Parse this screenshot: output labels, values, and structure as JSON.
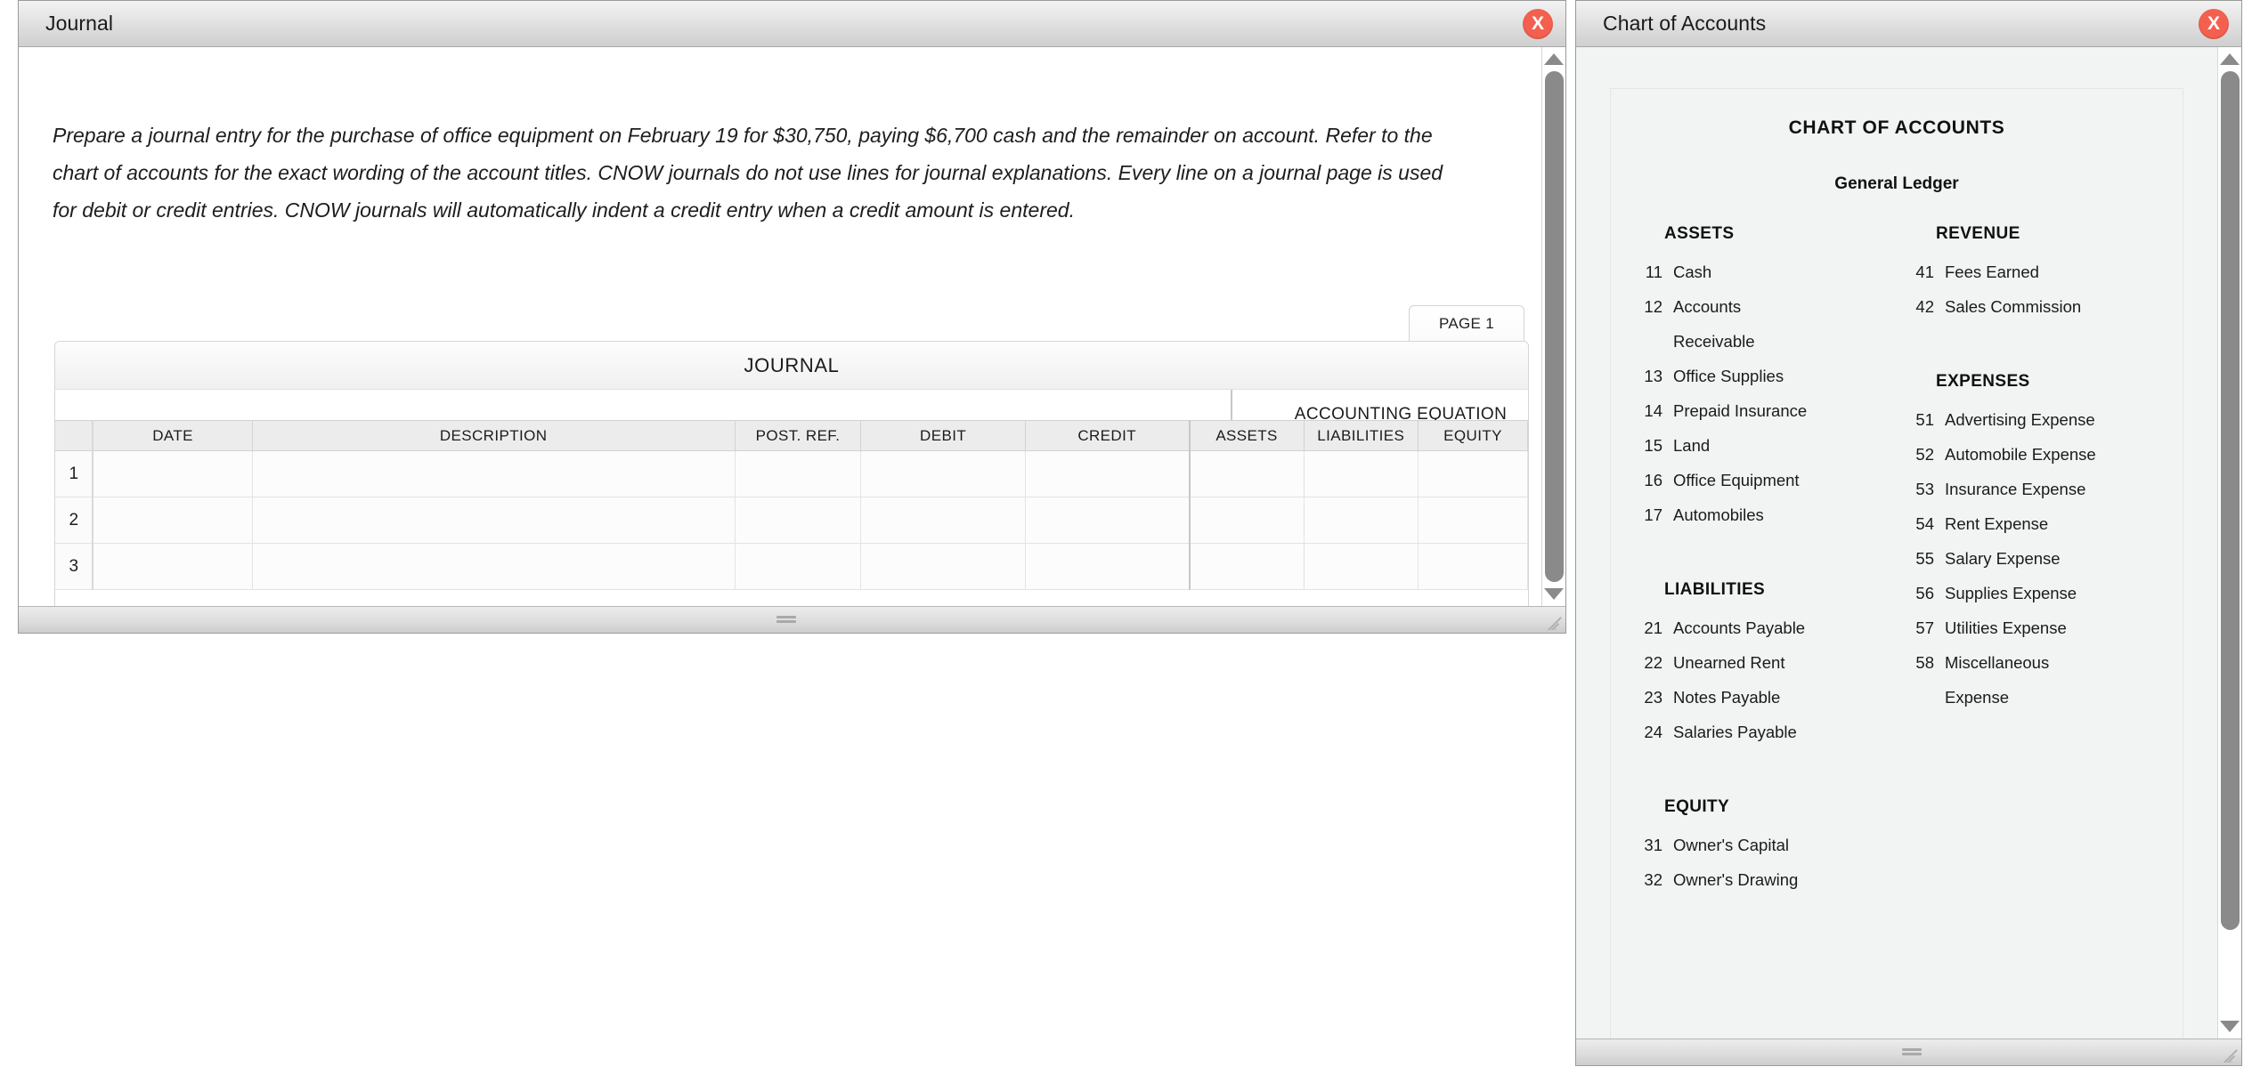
{
  "journal_window": {
    "title": "Journal",
    "close_label": "X",
    "instructions": "Prepare a journal entry for the purchase of office equipment on February 19 for $30,750, paying $6,700 cash and the remainder on account. Refer to the chart of accounts for the exact wording of the account titles. CNOW journals do not use lines for journal explanations. Every line on a journal page is used for debit or credit entries. CNOW journals will automatically indent a credit entry when a credit amount is entered.",
    "page_tab": "PAGE 1",
    "sheet_caption": "JOURNAL",
    "accounting_equation_banner": "ACCOUNTING EQUATION",
    "columns": [
      "",
      "DATE",
      "DESCRIPTION",
      "POST. REF.",
      "DEBIT",
      "CREDIT",
      "ASSETS",
      "LIABILITIES",
      "EQUITY"
    ],
    "rows": [
      {
        "num": "1",
        "date": "",
        "description": "",
        "post_ref": "",
        "debit": "",
        "credit": "",
        "assets": "",
        "liabilities": "",
        "equity": ""
      },
      {
        "num": "2",
        "date": "",
        "description": "",
        "post_ref": "",
        "debit": "",
        "credit": "",
        "assets": "",
        "liabilities": "",
        "equity": ""
      },
      {
        "num": "3",
        "date": "",
        "description": "",
        "post_ref": "",
        "debit": "",
        "credit": "",
        "assets": "",
        "liabilities": "",
        "equity": ""
      }
    ]
  },
  "coa_window": {
    "title": "Chart of Accounts",
    "close_label": "X",
    "heading": "CHART OF ACCOUNTS",
    "subheading": "General Ledger",
    "left_sections": [
      {
        "name": "ASSETS",
        "items": [
          {
            "num": "11",
            "name": "Cash"
          },
          {
            "num": "12",
            "name": "Accounts"
          },
          {
            "num": "",
            "name": "Receivable"
          },
          {
            "num": "13",
            "name": "Office Supplies"
          },
          {
            "num": "14",
            "name": "Prepaid Insurance"
          },
          {
            "num": "15",
            "name": "Land"
          },
          {
            "num": "16",
            "name": "Office Equipment"
          },
          {
            "num": "17",
            "name": "Automobiles"
          }
        ]
      },
      {
        "name": "LIABILITIES",
        "items": [
          {
            "num": "21",
            "name": "Accounts Payable"
          },
          {
            "num": "22",
            "name": "Unearned Rent"
          },
          {
            "num": "23",
            "name": "Notes Payable"
          },
          {
            "num": "24",
            "name": "Salaries Payable"
          }
        ]
      },
      {
        "name": "EQUITY",
        "items": [
          {
            "num": "31",
            "name": "Owner's Capital"
          },
          {
            "num": "32",
            "name": "Owner's Drawing"
          }
        ]
      }
    ],
    "right_sections": [
      {
        "name": "REVENUE",
        "items": [
          {
            "num": "41",
            "name": "Fees Earned"
          },
          {
            "num": "42",
            "name": "Sales Commission"
          }
        ]
      },
      {
        "name": "EXPENSES",
        "items": [
          {
            "num": "51",
            "name": "Advertising Expense"
          },
          {
            "num": "52",
            "name": "Automobile Expense"
          },
          {
            "num": "53",
            "name": "Insurance Expense"
          },
          {
            "num": "54",
            "name": "Rent Expense"
          },
          {
            "num": "55",
            "name": "Salary Expense"
          },
          {
            "num": "56",
            "name": "Supplies Expense"
          },
          {
            "num": "57",
            "name": "Utilities Expense"
          },
          {
            "num": "58",
            "name": "Miscellaneous"
          },
          {
            "num": "",
            "name": "Expense"
          }
        ]
      }
    ]
  },
  "colors": {
    "close_button": "#f4604f",
    "scrollbar_thumb": "#8a8a8a",
    "titlebar": "#d9d9d9",
    "panel_background": "#f2f3f3"
  }
}
